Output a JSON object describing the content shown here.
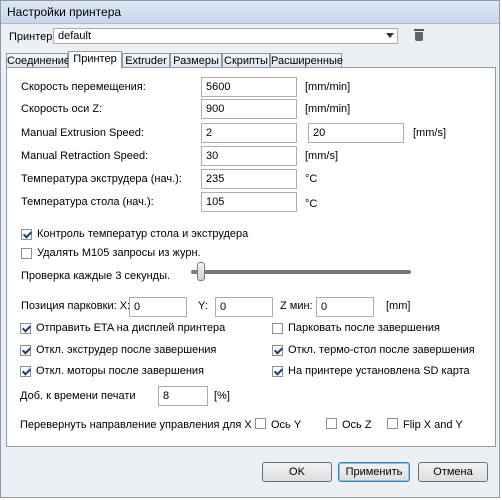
{
  "window": {
    "title": "Настройки принтера"
  },
  "printer": {
    "label": "Принтер:",
    "value": "default"
  },
  "tabs": [
    {
      "label": "Соединение"
    },
    {
      "label": "Принтер"
    },
    {
      "label": "Extruder"
    },
    {
      "label": "Размеры"
    },
    {
      "label": "Скрипты"
    },
    {
      "label": "Расширенные"
    }
  ],
  "fields": {
    "move_speed": {
      "label": "Скорость перемещения:",
      "value": "5600",
      "unit": "[mm/min]"
    },
    "z_speed": {
      "label": "Скорость оси Z:",
      "value": "900",
      "unit": "[mm/min]"
    },
    "manual_extrusion": {
      "label": "Manual Extrusion Speed:",
      "value1": "2",
      "value2": "20",
      "unit": "[mm/s]"
    },
    "manual_retraction": {
      "label": "Manual Retraction Speed:",
      "value": "30",
      "unit": "[mm/s]"
    },
    "extruder_temp": {
      "label": "Температура экструдера (нач.):",
      "value": "235",
      "unit": "°C"
    },
    "bed_temp": {
      "label": "Температура стола (нач.):",
      "value": "105",
      "unit": "°C"
    }
  },
  "checks": {
    "temp_control": {
      "label": "Контроль температур стола и экструдера",
      "checked": true
    },
    "remove_m105": {
      "label": "Удалять M105 запросы из журн.",
      "checked": false
    }
  },
  "interval": {
    "label": "Проверка каждые 3 секунды.",
    "value": 3
  },
  "park": {
    "label": "Позиция парковки: X:",
    "x": "0",
    "y_label": "Y:",
    "y": "0",
    "z_label": "Z мин:",
    "z": "0",
    "unit": "[mm]"
  },
  "options": {
    "send_eta": {
      "label": "Отправить ETA на дисплей принтера",
      "checked": true
    },
    "park_after": {
      "label": "Парковать после завершения",
      "checked": false
    },
    "disable_extruder": {
      "label": "Откл. экструдер после завершения",
      "checked": true
    },
    "disable_bed": {
      "label": "Откл. термо-стол после завершения",
      "checked": true
    },
    "disable_motors": {
      "label": "Откл. моторы после завершения",
      "checked": true
    },
    "sd_card": {
      "label": "На принтере установлена SD карта",
      "checked": true
    }
  },
  "print_time": {
    "label": "Доб. к времени печати",
    "value": "8",
    "unit": "[%]"
  },
  "invert": {
    "label": "Перевернуть направление управления для  X",
    "axis_y": {
      "label": "Ось Y",
      "checked": false
    },
    "axis_z": {
      "label": "Ось Z",
      "checked": false
    },
    "flip_xy": {
      "label": "Flip X and Y",
      "checked": false
    }
  },
  "buttons": {
    "ok": "OK",
    "apply": "Применить",
    "cancel": "Отмена"
  }
}
